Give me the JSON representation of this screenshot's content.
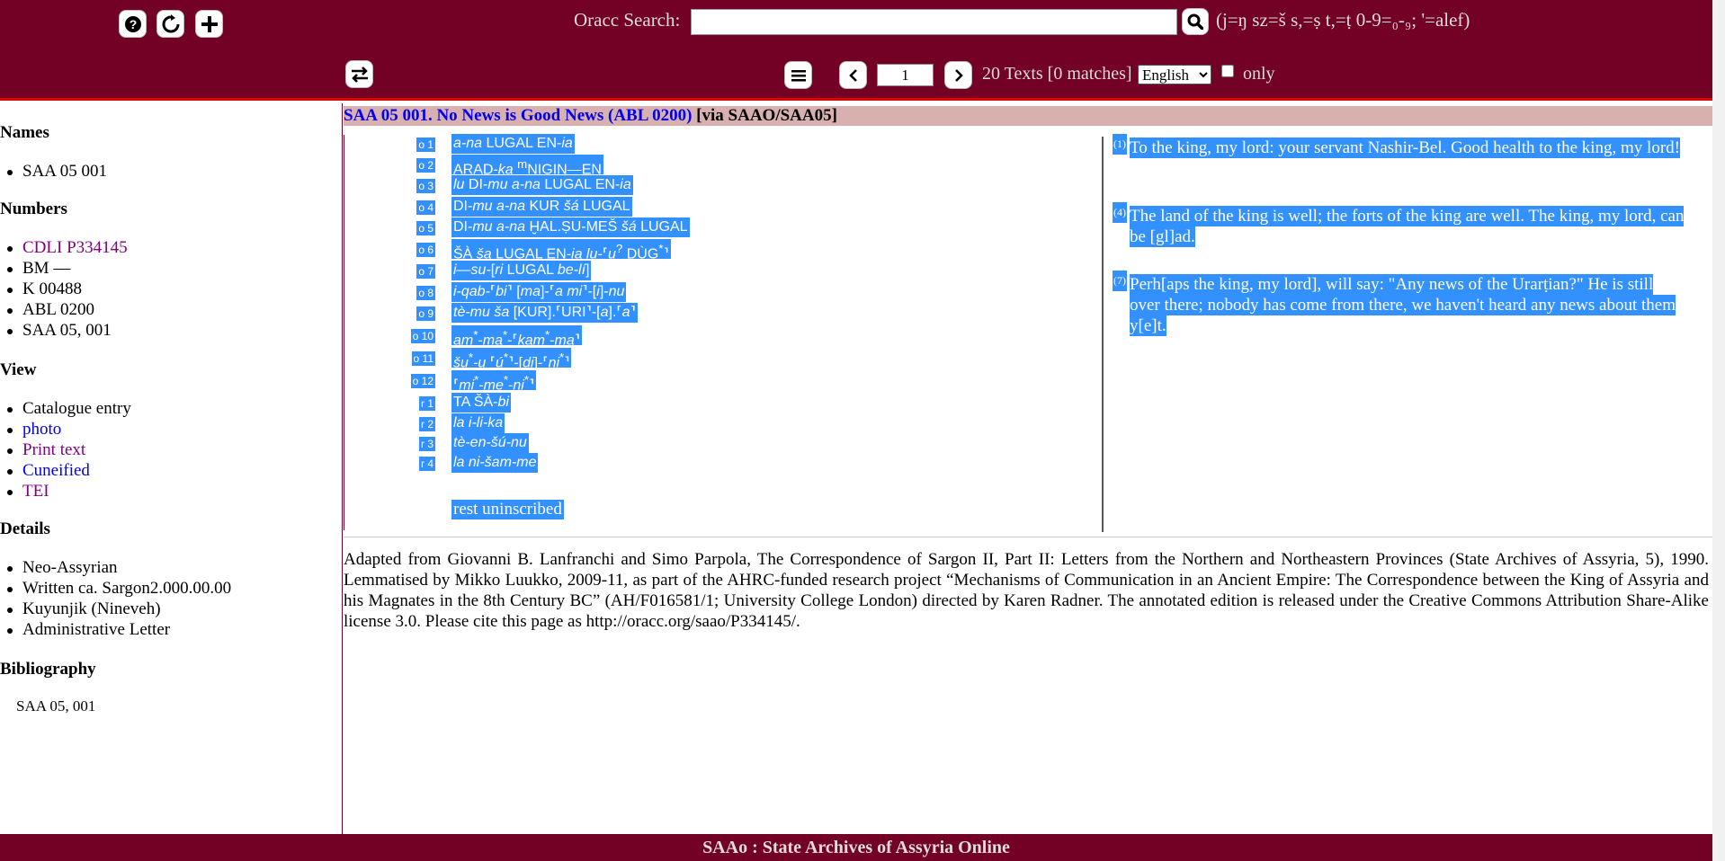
{
  "header": {
    "help_icon": "question-icon",
    "reload_icon": "reload-icon",
    "add_icon": "plus-icon",
    "search_label": "Oracc Search:",
    "search_value": "",
    "search_hint": "(j=ŋ sz=š s,=ṣ t,=ṭ 0-9=₀-₉; '=alef)",
    "swap_icon": "swap-icon",
    "menu_icon": "menu-icon",
    "page_value": "1",
    "results_text": "20 Texts [0 matches]",
    "language_selected": "English",
    "only_label": "only"
  },
  "sidebar": {
    "names_heading": "Names",
    "names": [
      "SAA 05 001"
    ],
    "numbers_heading": "Numbers",
    "numbers": [
      {
        "text": "CDLI P334145",
        "style": "visited"
      },
      {
        "text": "BM —",
        "style": "plain"
      },
      {
        "text": "K 00488",
        "style": "plain"
      },
      {
        "text": "ABL 0200",
        "style": "plain"
      },
      {
        "text": "SAA 05, 001",
        "style": "plain"
      }
    ],
    "view_heading": "View",
    "view": [
      {
        "text": "Catalogue entry",
        "style": "plain"
      },
      {
        "text": "photo",
        "style": "link"
      },
      {
        "text": "Print text",
        "style": "visited"
      },
      {
        "text": "Cuneified",
        "style": "link"
      },
      {
        "text": "TEI",
        "style": "visited"
      }
    ],
    "details_heading": "Details",
    "details": [
      "Neo-Assyrian",
      "Written ca. Sargon2.000.00.00",
      "Kuyunjik (Nineveh)",
      "Administrative Letter"
    ],
    "bibliography_heading": "Bibliography",
    "bibliography": [
      "SAA 05, 001"
    ]
  },
  "main": {
    "title_link": "SAA 05 001. No News is Good News (ABL 0200)",
    "title_suffix": " [via SAAO/SAA05]",
    "lines": [
      {
        "no": "o 1",
        "html": "<i>a-na</i> LUGAL EN-<i>ia</i>"
      },
      {
        "no": "o 2",
        "html": "ARAD-<i>ka</i> <sup>m</sup>NIGIN—EN"
      },
      {
        "no": "o 3",
        "html": "<i>lu</i> DI-<i>mu a-na</i> LUGAL EN-<i>ia</i>"
      },
      {
        "no": "o 4",
        "html": "DI-<i>mu a-na</i> KUR <i>šá</i> LUGAL"
      },
      {
        "no": "o 5",
        "html": "DI-<i>mu a-na</i> ḪAL.ṢU-MEŠ <i>šá</i> LUGAL"
      },
      {
        "no": "o 6",
        "html": "ŠÀ <i>ša</i> LUGAL EN-<i>ia lu-</i>⸢<i>u</i><sup>?</sup> DÙG<sup>*</sup>⸣"
      },
      {
        "no": "o 7",
        "html": "<i>i—su-</i>[<i>ri</i> LUGAL <i>be-lí</i>]"
      },
      {
        "no": "o 8",
        "html": "<i>i-qab-</i>⸢<i>bi</i>⸣ [<i>ma</i>]-⸢<i>a mi</i>⸣-[<i>i</i>]-<i>nu</i>"
      },
      {
        "no": "o 9",
        "html": "<i>tè-mu ša</i> [KUR].⸢URI⸣-[<i>a</i>].⸢<i>a</i>⸣"
      },
      {
        "no": "o 10",
        "html": "<i>am</i><sup>*</sup>-<i>ma</i><sup>*</sup>-⸢<i>kam</i><sup>*</sup>-<i>ma</i>⸣"
      },
      {
        "no": "o 11",
        "html": "<i>šu</i><sup>*</sup>-<i>u</i> ⸢<i>ú</i><sup>*</sup>⸣-[<i>di</i>]-⸢<i>ni</i><sup>*</sup>⸣"
      },
      {
        "no": "o 12",
        "html": "⸢<i>mi</i><sup>*</sup>-<i>me</i><sup>*</sup>-<i>ni</i><sup>*</sup>⸣"
      },
      {
        "no": "r 1",
        "html": "TA ŠÀ-<i>bi</i>"
      },
      {
        "no": "r 2",
        "html": "<i>la i-li-ka</i>"
      },
      {
        "no": "r 3",
        "html": "<i>tè-en-šú-nu</i>"
      },
      {
        "no": "r 4",
        "html": "<i>la ni-šam-me</i>"
      }
    ],
    "rest_uninscribed": "rest uninscribed",
    "translations": [
      {
        "no": "(1)",
        "text": "To the king, my lord: your servant Nashir-Bel. Good health to the king, my lord!"
      },
      {
        "no": "(4)",
        "text": "The land of the king is well; the forts of the king are well. The king, my lord, can be [gl]ad."
      },
      {
        "no": "(7)",
        "text": "Perh[aps the king, my lord], will say: \"Any news of the Urarṭian?\" He is still over there; nobody has come from there, we haven't heard any news about them y[e]t."
      }
    ],
    "colophon": "Adapted from Giovanni B. Lanfranchi and Simo Parpola, The Correspondence of Sargon II, Part II: Letters from the Northern and Northeastern Provinces (State Archives of Assyria, 5), 1990. Lemmatised by Mikko Luukko, 2009-11, as part of the AHRC-funded research project “Mechanisms of Communication in an Ancient Empire: The Correspondence between the King of Assyria and his Magnates in the 8th Century BC” (AH/F016581/1; University College London) directed by Karen Radner. The annotated edition is released under the Creative Commons Attribution Share-Alike license 3.0. Please cite this page as http://oracc.org/saao/P334145/."
  },
  "footer": {
    "text": "SAAo : State Archives of Assyria Online"
  },
  "colors": {
    "header_bg": "#730025",
    "selection": "#3390ff",
    "title_bar": "#d8b0b0",
    "link": "#0000ee",
    "visited": "#800080"
  }
}
